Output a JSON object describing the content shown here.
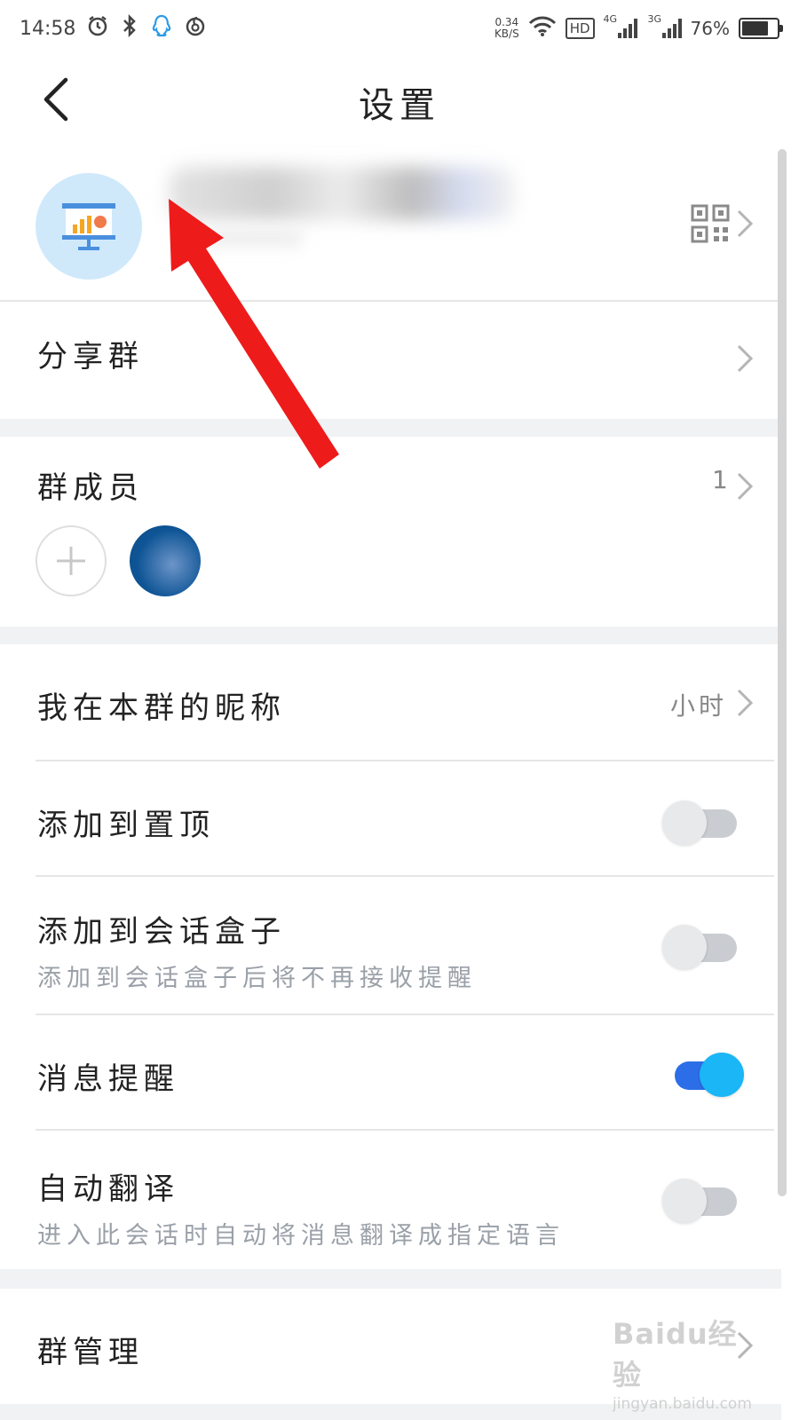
{
  "status_bar": {
    "time": "14:58",
    "net_speed_value": "0.34",
    "net_speed_unit": "KB/S",
    "hd_label": "HD",
    "net_4g": "4G",
    "net_3g": "3G",
    "battery": "76%",
    "icons": [
      "alarm-icon",
      "bluetooth-icon",
      "qq-icon",
      "netease-music-icon",
      "wifi-icon"
    ]
  },
  "header": {
    "title": "设置"
  },
  "profile": {
    "avatar_icon": "presentation-chart-icon",
    "qr_icon": "qr-code-icon"
  },
  "rows": {
    "share": {
      "label": "分享群"
    },
    "members": {
      "label": "群成员",
      "count": "1"
    },
    "nickname": {
      "label": "我在本群的昵称",
      "value": "小时"
    },
    "pin": {
      "label": "添加到置顶",
      "on": false
    },
    "box": {
      "label": "添加到会话盒子",
      "sub": "添加到会话盒子后将不再接收提醒",
      "on": false
    },
    "notify": {
      "label": "消息提醒",
      "on": true
    },
    "translate": {
      "label": "自动翻译",
      "sub": "进入此会话时自动将消息翻译成指定语言",
      "on": false
    },
    "manage": {
      "label": "群管理"
    }
  },
  "watermark": {
    "main": "Baidu经验",
    "sub": "jingyan.baidu.com"
  },
  "colors": {
    "toggle_on_track": "#2c6ee8",
    "toggle_on_knob": "#1ab6f5",
    "annotation_arrow": "#ee1b1b",
    "avatar_bg": "#cfe9fb"
  }
}
